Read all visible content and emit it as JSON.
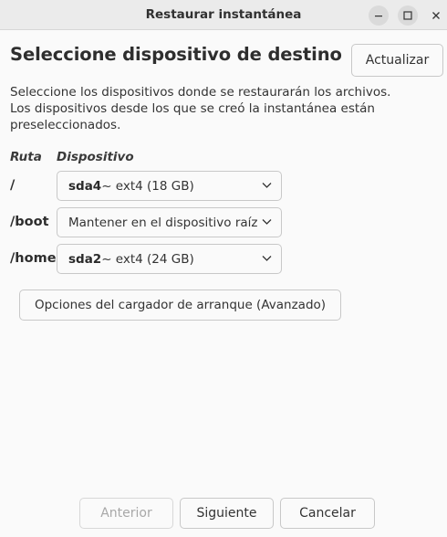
{
  "window": {
    "title": "Restaurar instantánea"
  },
  "header": {
    "heading": "Seleccione dispositivo de destino",
    "refresh_label": "Actualizar"
  },
  "description": {
    "line1": "Seleccione los dispositivos donde se restaurarán los archivos.",
    "line2": "Los dispositivos desde los que se creó la instantánea están",
    "line3": "preseleccionados."
  },
  "columns": {
    "path": "Ruta",
    "device": "Dispositivo"
  },
  "rows": [
    {
      "path": "/",
      "device_name": "sda4",
      "device_detail": " ~ ext4 (18 GB)"
    },
    {
      "path": "/boot",
      "device_name": "",
      "device_detail": "Mantener en el dispositivo raíz"
    },
    {
      "path": "/home",
      "device_name": "sda2",
      "device_detail": " ~ ext4 (24 GB)"
    }
  ],
  "bootloader_button": "Opciones del cargador de arranque (Avanzado)",
  "footer": {
    "prev_label": "Anterior",
    "prev_enabled": false,
    "next_label": "Siguiente",
    "cancel_label": "Cancelar"
  }
}
